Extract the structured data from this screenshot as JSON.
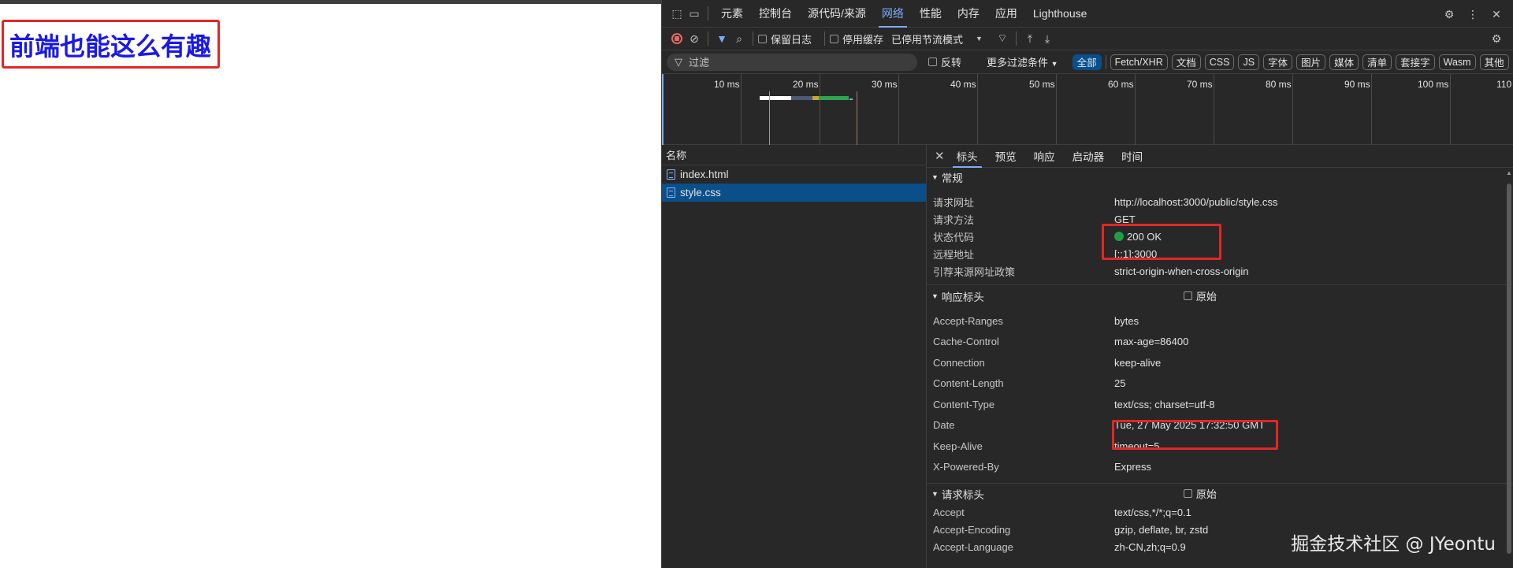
{
  "page": {
    "heading": "前端也能这么有趣"
  },
  "devtools": {
    "panel_tabs": [
      "元素",
      "控制台",
      "源代码/来源",
      "网络",
      "性能",
      "内存",
      "应用",
      "Lighthouse"
    ],
    "active_panel": "网络",
    "toolbar": {
      "preserve_log": "保留日志",
      "disable_cache": "停用缓存",
      "throttling": "已停用节流模式"
    },
    "filter": {
      "placeholder": "过滤",
      "invert": "反转",
      "more_filters": "更多过滤条件",
      "chips": [
        "全部",
        "Fetch/XHR",
        "文档",
        "CSS",
        "JS",
        "字体",
        "图片",
        "媒体",
        "清单",
        "套接字",
        "Wasm",
        "其他"
      ],
      "active_chip": "全部"
    },
    "overview_ticks": [
      "10 ms",
      "20 ms",
      "30 ms",
      "40 ms",
      "50 ms",
      "60 ms",
      "70 ms",
      "80 ms",
      "90 ms",
      "100 ms",
      "110"
    ],
    "request_list": {
      "header": "名称",
      "rows": [
        "index.html",
        "style.css"
      ],
      "selected": "style.css"
    },
    "details": {
      "tabs": [
        "标头",
        "预览",
        "响应",
        "启动器",
        "时间"
      ],
      "active_tab": "标头",
      "general": {
        "title": "常规",
        "rows": [
          {
            "k": "请求网址",
            "v": "http://localhost:3000/public/style.css"
          },
          {
            "k": "请求方法",
            "v": "GET"
          },
          {
            "k": "状态代码",
            "v": "200 OK"
          },
          {
            "k": "远程地址",
            "v": "[::1]:3000"
          },
          {
            "k": "引荐来源网址政策",
            "v": "strict-origin-when-cross-origin"
          }
        ]
      },
      "response_headers": {
        "title": "响应标头",
        "raw": "原始",
        "rows": [
          {
            "k": "Accept-Ranges",
            "v": "bytes"
          },
          {
            "k": "Cache-Control",
            "v": "max-age=86400"
          },
          {
            "k": "Connection",
            "v": "keep-alive"
          },
          {
            "k": "Content-Length",
            "v": "25"
          },
          {
            "k": "Content-Type",
            "v": "text/css; charset=utf-8"
          },
          {
            "k": "Date",
            "v": "Tue, 27 May 2025 17:32:50 GMT"
          },
          {
            "k": "Keep-Alive",
            "v": "timeout=5"
          },
          {
            "k": "X-Powered-By",
            "v": "Express"
          }
        ]
      },
      "request_headers": {
        "title": "请求标头",
        "raw": "原始",
        "rows": [
          {
            "k": "Accept",
            "v": "text/css,*/*;q=0.1"
          },
          {
            "k": "Accept-Encoding",
            "v": "gzip, deflate, br, zstd"
          },
          {
            "k": "Accept-Language",
            "v": "zh-CN,zh;q=0.9"
          }
        ]
      }
    },
    "status_color": "#1e9e45",
    "accent_color": "#7cacf8"
  },
  "watermark": "掘金技术社区 @ JYeontu"
}
